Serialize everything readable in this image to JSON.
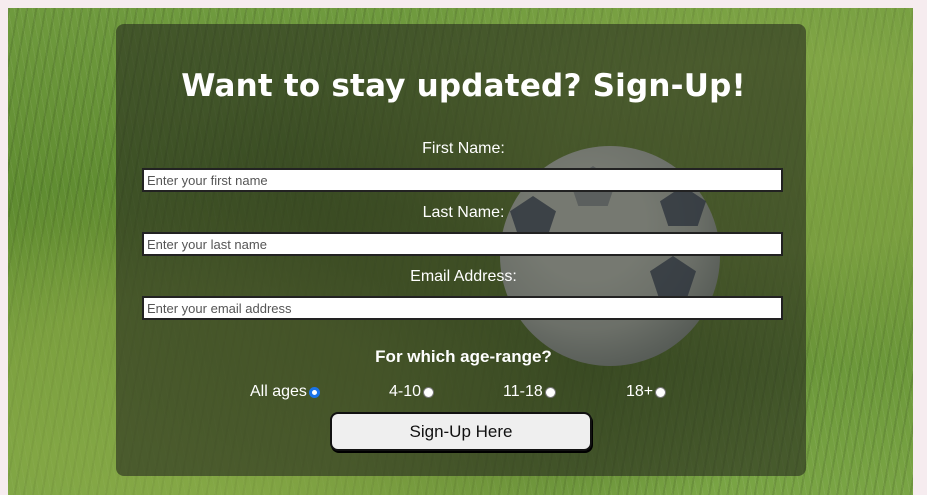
{
  "form": {
    "title": "Want to stay updated? Sign-Up!",
    "first_name": {
      "label": "First Name:",
      "placeholder": "Enter your first name",
      "value": ""
    },
    "last_name": {
      "label": "Last Name:",
      "placeholder": "Enter your last name",
      "value": ""
    },
    "email": {
      "label": "Email Address:",
      "placeholder": "Enter your email address",
      "value": ""
    },
    "age_heading": "For which age-range?",
    "age_options": [
      {
        "label": "All ages",
        "checked": true
      },
      {
        "label": "4-10",
        "checked": false
      },
      {
        "label": "11-18",
        "checked": false
      },
      {
        "label": "18+",
        "checked": false
      }
    ],
    "submit_label": "Sign-Up Here"
  },
  "colors": {
    "page_background": "#f6ecef",
    "card_overlay": "rgba(40,45,30,0.62)",
    "radio_accent": "#1a73e8"
  },
  "icons": {
    "background_image": "soccer-ball-on-grass"
  }
}
